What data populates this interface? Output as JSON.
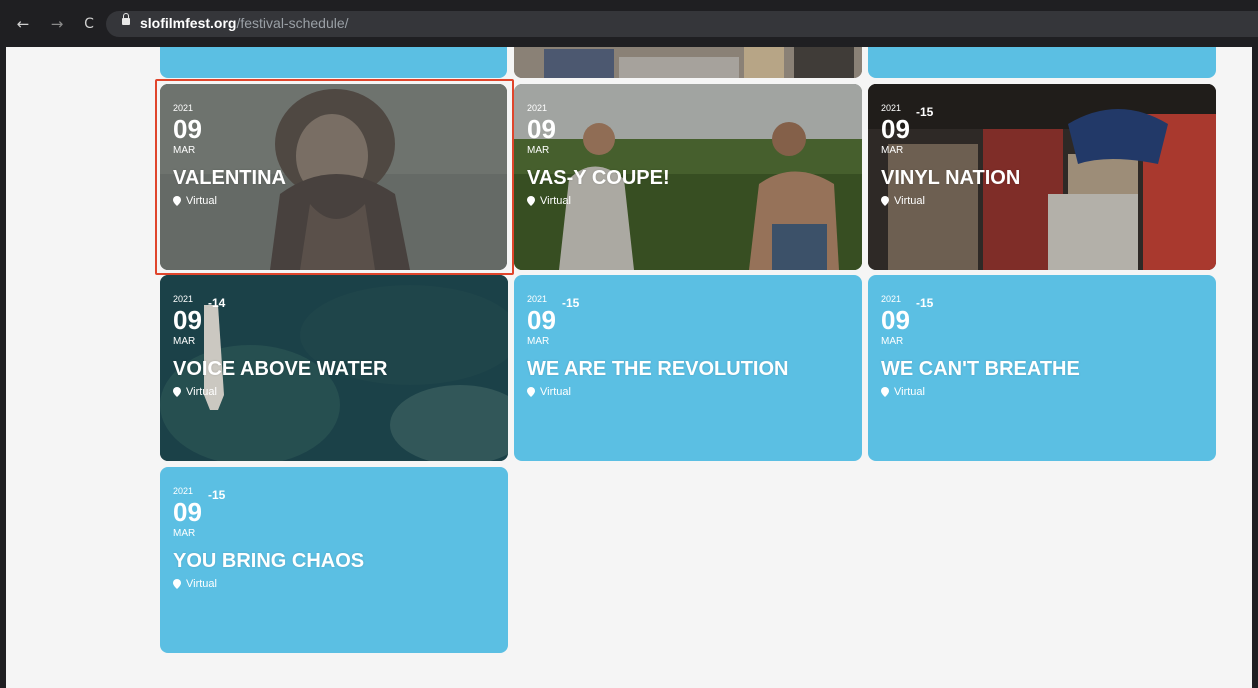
{
  "browser": {
    "url_domain": "slofilmfest.org",
    "url_path": "/festival-schedule/"
  },
  "colors": {
    "card_accent": "#5bbfe3",
    "highlight_border": "#e0452c"
  },
  "cards": [
    {
      "year": "2021",
      "day": "09",
      "suffix": "",
      "month": "MAR",
      "title": "VALENTINA",
      "location": "Virtual",
      "image": true
    },
    {
      "year": "2021",
      "day": "09",
      "suffix": "",
      "month": "MAR",
      "title": "VAS-Y COUPE!",
      "location": "Virtual",
      "image": true
    },
    {
      "year": "2021",
      "day": "09",
      "suffix": "-15",
      "month": "MAR",
      "title": "VINYL NATION",
      "location": "Virtual",
      "image": true
    },
    {
      "year": "2021",
      "day": "09",
      "suffix": "-14",
      "month": "MAR",
      "title": "VOICE ABOVE WATER",
      "location": "Virtual",
      "image": true
    },
    {
      "year": "2021",
      "day": "09",
      "suffix": "-15",
      "month": "MAR",
      "title": "WE ARE THE REVOLUTION",
      "location": "Virtual",
      "image": false
    },
    {
      "year": "2021",
      "day": "09",
      "suffix": "-15",
      "month": "MAR",
      "title": "WE CAN'T BREATHE",
      "location": "Virtual",
      "image": false
    },
    {
      "year": "2021",
      "day": "09",
      "suffix": "-15",
      "month": "MAR",
      "title": "YOU BRING CHAOS",
      "location": "Virtual",
      "image": false
    }
  ]
}
